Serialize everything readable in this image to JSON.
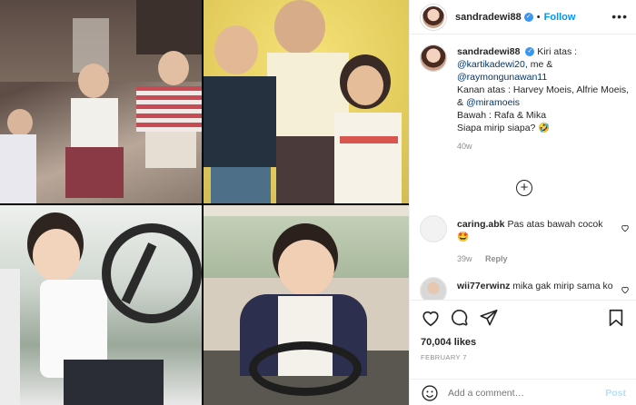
{
  "header": {
    "username": "sandradewi88",
    "separator": "•",
    "follow_label": "Follow",
    "more_label": "•••"
  },
  "caption": {
    "username": "sandradewi88",
    "line1_prefix": "Kiri atas :",
    "mention1": "@kartikadewi20",
    "line2_middle": ", me &",
    "mention2": "@raymongunawan11",
    "line3": "Kanan atas : Harvey Moeis, Alfrie Moeis,",
    "line4_prefix": "&",
    "mention3": "@miramoeis",
    "line5": "Bawah : Rafa & Mika",
    "line6": "Siapa mirip siapa? 🤣",
    "time": "40w"
  },
  "load_more_label": "+",
  "comments": [
    {
      "username": "caring.abk",
      "text": "Pas atas bawah cocok",
      "emoji": "🤩",
      "time": "39w",
      "reply_label": "Reply"
    },
    {
      "username": "wii77erwinz",
      "text": "mika gak mirip sama ko"
    }
  ],
  "stats": {
    "likes": "70,004 likes",
    "date": "FEBRUARY 7"
  },
  "add_comment": {
    "placeholder": "Add a comment…",
    "post_label": "Post"
  },
  "colors": {
    "accent": "#0095f6",
    "verified": "#3897f0",
    "muted": "#8e8e8e"
  }
}
